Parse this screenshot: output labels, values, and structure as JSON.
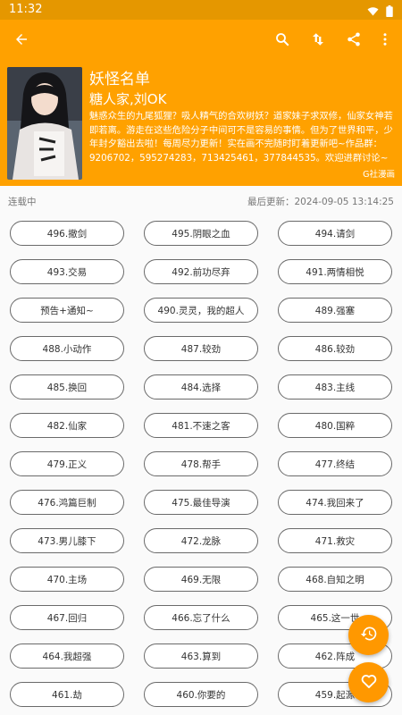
{
  "status_bar": {
    "time": "11:32"
  },
  "app_bar": {
    "icons": [
      "back-arrow-icon",
      "search-icon",
      "sort-icon",
      "share-icon",
      "more-vert-icon"
    ]
  },
  "book": {
    "title": "妖怪名单",
    "author": "糖人家,刘OK",
    "description": "魅惑众生的九尾狐狸？吸人精气的合欢树妖？道家妹子求双修，仙家女神若即若离。游走在这些危险分子中间可不是容易的事情。但为了世界和平，少年封夕豁出去啦！每周尽力更新！实在画不完随时盯着更新吧~作品群：9206702，595274283，713425461，377844535。欢迎进群讨论~",
    "source": "G社漫画"
  },
  "info": {
    "status": "连载中",
    "last_updated": "最后更新：2024-09-05 13:14:25"
  },
  "chapters": [
    "496.撤剑",
    "495.阴眼之血",
    "494.请剑",
    "493.交易",
    "492.前功尽弃",
    "491.两情相悦",
    "预告+通知~",
    "490.灵灵，我的超人",
    "489.强塞",
    "488.小动作",
    "487.较劲",
    "486.较劲",
    "485.换回",
    "484.选择",
    "483.主线",
    "482.仙家",
    "481.不速之客",
    "480.国粹",
    "479.正义",
    "478.帮手",
    "477.终结",
    "476.鸿篇巨制",
    "475.最佳导演",
    "474.我回来了",
    "473.男儿膝下",
    "472.龙脉",
    "471.救灾",
    "470.主场",
    "469.无限",
    "468.自知之明",
    "467.回归",
    "466.忘了什么",
    "465.这一世",
    "464.我超强",
    "463.算到",
    "462.阵成",
    "461.劫",
    "460.你要的",
    "459.起源"
  ],
  "fabs": {
    "history": "history-icon",
    "favorite": "heart-outline-icon"
  },
  "colors": {
    "primary": "#ffa100",
    "status_bar": "#e59700",
    "fab": "#ff9800",
    "background": "#fafafa"
  }
}
